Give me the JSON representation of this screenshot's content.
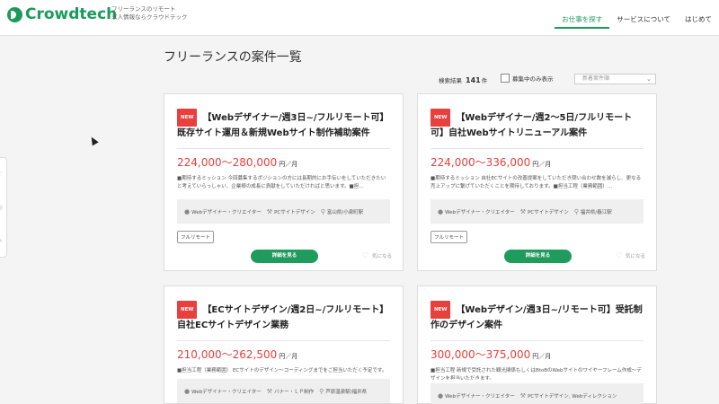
{
  "header": {
    "logo_text": "Crowdtech",
    "tagline_line1": "フリーランスのリモート",
    "tagline_line2": "求人情報ならクラウドテック",
    "nav": [
      "お仕事を探す",
      "サービスについて",
      "はじめて"
    ]
  },
  "page_title": "フリーランスの案件一覧",
  "controls": {
    "results_label": "検索結果",
    "results_count": "141",
    "results_suffix": "件",
    "only_open_label": "募集中のみ表示",
    "sort_value": "新着案件順"
  },
  "jobs": [
    {
      "badge": "NEW",
      "title": "【Webデザイナー/週3日~/フルリモート可】既存サイト運用＆新規Webサイト制作補助案件",
      "price": "224,000〜280,000",
      "unit": "円／月",
      "desc": "■期待するミッション 今回募集するポジションの方には長期的にお手伝いをしていただきたいと考えていらっしゃい、企業様の成長に貢献をしていただければと思います。■担…",
      "role": "Webデザイナー・クリエイター",
      "skill": "PCサイトデザイン",
      "location": "富山県/小泉町駅",
      "tag": "フルリモート",
      "detail_label": "詳細を見る",
      "fav_label": "気になる"
    },
    {
      "badge": "NEW",
      "title": "【Webデザイナー/週2〜5日/フルリモート可】自社Webサイトリニューアル案件",
      "price": "224,000〜336,000",
      "unit": "円／月",
      "desc": "■期待するミッション 自社ECサイトの改善提案をしていただき問い合わせ数を減らし、更なる売上アップに繋げていただくことを期待しております。■担当工程（業務範囲）…",
      "role": "Webデザイナー・クリエイター",
      "skill": "PCサイトデザイン",
      "location": "福井県/春江駅",
      "tag": "フルリモート",
      "detail_label": "詳細を見る",
      "fav_label": "気になる"
    },
    {
      "badge": "NEW",
      "title": "【ECサイトデザイン/週2日~/フルリモート】自社ECサイトデザイン業務",
      "price": "210,000〜262,500",
      "unit": "円／月",
      "desc": "■担当工程（業務範囲） ECサイトのデザイン〜コーディングまでをご担当いただく予定です。",
      "role": "Webデザイナー・クリエイター",
      "skill": "バナー・ＬＰ制作",
      "location": "芦原温泉駅/福井県"
    },
    {
      "badge": "NEW",
      "title": "【Webデザイン/週3日~/リモート可】受託制作のデザイン案件",
      "price": "300,000〜375,000",
      "unit": "円／月",
      "desc": "■担当工程 新規で受託された観光関係もしくはBtoBのWebサイトのワイヤーフレーム作成〜デザインを担当いただきます。",
      "role": "Webデザイナー・クリエイター",
      "skill": "PCサイトデザイン, Webディレクション"
    }
  ]
}
